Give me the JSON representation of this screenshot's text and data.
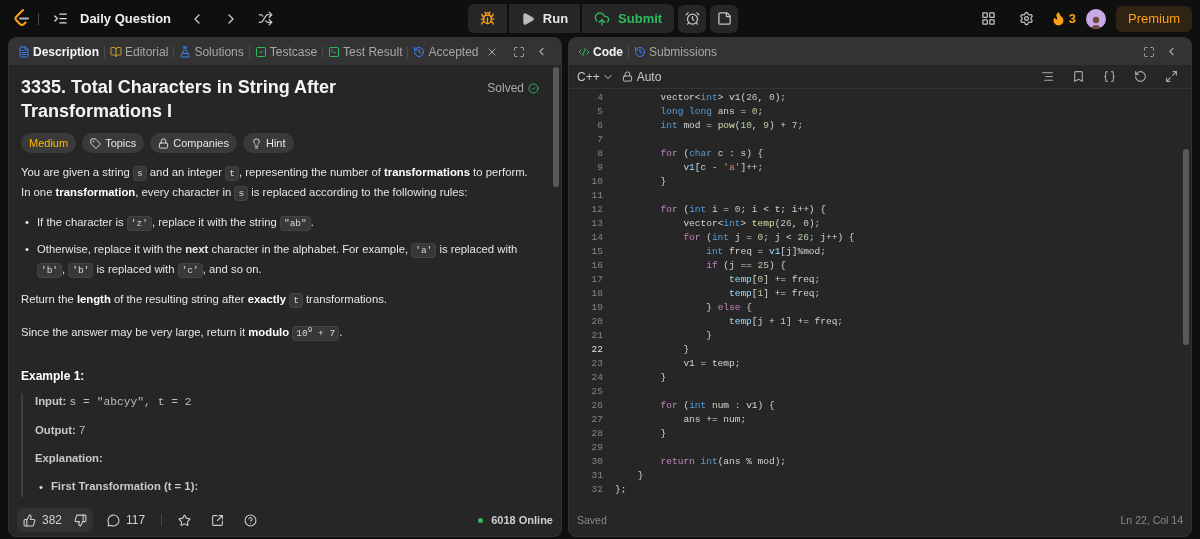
{
  "top_bar": {
    "title": "Daily Question",
    "run_label": "Run",
    "submit_label": "Submit",
    "streak": "3",
    "premium_label": "Premium"
  },
  "description_panel": {
    "tabs": [
      {
        "label": "Description",
        "selected": true,
        "closable": false
      },
      {
        "label": "Editorial",
        "selected": false,
        "closable": false
      },
      {
        "label": "Solutions",
        "selected": false,
        "closable": false
      },
      {
        "label": "Testcase",
        "selected": false,
        "closable": false
      },
      {
        "label": "Test Result",
        "selected": false,
        "closable": false
      },
      {
        "label": "Accepted",
        "selected": false,
        "closable": true
      }
    ],
    "title": "3335. Total Characters in String After Transformations I",
    "solved_label": "Solved",
    "difficulty": "Medium",
    "tags": [
      "Topics",
      "Companies",
      "Hint"
    ],
    "content": [
      {
        "kind": "paragraph",
        "segments": [
          {
            "kind": "text",
            "text": "You are given a string "
          },
          {
            "kind": "code",
            "text": "s"
          },
          {
            "kind": "text",
            "text": " and an integer "
          },
          {
            "kind": "code",
            "text": "t"
          },
          {
            "kind": "text",
            "text": ", representing the number of **transformations** to perform. In one **transformation**, every character in "
          },
          {
            "kind": "code",
            "text": "s"
          },
          {
            "kind": "text",
            "text": " is replaced according to the following rules:"
          }
        ]
      },
      {
        "kind": "bullet",
        "marker": "•",
        "segments": [
          {
            "kind": "text",
            "text": "If the character is "
          },
          {
            "kind": "code",
            "text": "'z'"
          },
          {
            "kind": "text",
            "text": ", replace it with the string "
          },
          {
            "kind": "code",
            "text": "\"ab\""
          },
          {
            "kind": "text",
            "text": "."
          }
        ]
      },
      {
        "kind": "bullet",
        "marker": "•",
        "segments": [
          {
            "kind": "text",
            "text": "Otherwise, replace it with the **next** character in the alphabet. For example, "
          },
          {
            "kind": "code",
            "text": "'a'"
          },
          {
            "kind": "text",
            "text": " is replaced with "
          },
          {
            "kind": "code",
            "text": "'b'"
          },
          {
            "kind": "text",
            "text": ", "
          },
          {
            "kind": "code",
            "text": "'b'"
          },
          {
            "kind": "text",
            "text": " is replaced with "
          },
          {
            "kind": "code",
            "text": "'c'"
          },
          {
            "kind": "text",
            "text": ", and so on."
          }
        ]
      },
      {
        "kind": "paragraph",
        "segments": [
          {
            "kind": "text",
            "text": "Return the **length** of the resulting string after **exactly** "
          },
          {
            "kind": "code",
            "text": "t"
          },
          {
            "kind": "text",
            "text": " transformations."
          }
        ]
      },
      {
        "kind": "paragraph",
        "segments": [
          {
            "kind": "text",
            "text": "Since the answer may be very large, return it **modulo** "
          },
          {
            "kind": "code",
            "text": "10$^{9}$ + 7"
          },
          {
            "kind": "text",
            "text": "."
          }
        ]
      },
      {
        "kind": "heading",
        "text": "Example 1:"
      },
      {
        "kind": "example",
        "lines": [
          {
            "label": "Input:",
            "value": "s = \"abcyy\", t = 2",
            "mono": true
          },
          {
            "label": "Output:",
            "value": "7",
            "mono": false
          },
          {
            "label": "Explanation:"
          }
        ],
        "bullets": [
          {
            "marker": "•",
            "text": "First Transformation (t = 1):"
          }
        ]
      }
    ],
    "likes": "382",
    "comments": "117",
    "online": "6018 Online"
  },
  "code_panel": {
    "tabs": [
      {
        "label": "Code",
        "selected": true
      },
      {
        "label": "Submissions",
        "selected": false
      }
    ],
    "language": "C++",
    "mode": "Auto",
    "lines": [
      {
        "number": "4",
        "current": false,
        "tokens": [
          {
            "kind": "plain",
            "text": "        vector<"
          },
          {
            "kind": "type",
            "text": "int"
          },
          {
            "kind": "plain",
            "text": "> v1("
          },
          {
            "kind": "number",
            "text": "26"
          },
          {
            "kind": "plain",
            "text": ", "
          },
          {
            "kind": "number",
            "text": "0"
          },
          {
            "kind": "plain",
            "text": ");"
          }
        ]
      },
      {
        "number": "5",
        "current": false,
        "tokens": [
          {
            "kind": "type",
            "text": "        long"
          },
          {
            "kind": "type",
            "text": " long"
          },
          {
            "kind": "plain",
            "text": " ans = "
          },
          {
            "kind": "number",
            "text": "0"
          },
          {
            "kind": "plain",
            "text": ";"
          }
        ]
      },
      {
        "number": "6",
        "current": false,
        "tokens": [
          {
            "kind": "type",
            "text": "        int"
          },
          {
            "kind": "plain",
            "text": " mod = "
          },
          {
            "kind": "function",
            "text": "pow"
          },
          {
            "kind": "plain",
            "text": "("
          },
          {
            "kind": "number",
            "text": "10"
          },
          {
            "kind": "plain",
            "text": ", "
          },
          {
            "kind": "number",
            "text": "9"
          },
          {
            "kind": "plain",
            "text": ") + "
          },
          {
            "kind": "number",
            "text": "7"
          },
          {
            "kind": "plain",
            "text": ";"
          }
        ]
      },
      {
        "number": "7",
        "current": false
      },
      {
        "number": "8",
        "current": false,
        "tokens": [
          {
            "kind": "keyword",
            "text": "        for"
          },
          {
            "kind": "plain",
            "text": " ("
          },
          {
            "kind": "type",
            "text": "char"
          },
          {
            "kind": "plain",
            "text": " c : s) {"
          }
        ]
      },
      {
        "number": "9",
        "current": false,
        "tokens": [
          {
            "kind": "variable",
            "text": "            v1"
          },
          {
            "kind": "plain",
            "text": "[c - "
          },
          {
            "kind": "string",
            "text": "'a'"
          },
          {
            "kind": "plain",
            "text": "]++;"
          }
        ]
      },
      {
        "number": "10",
        "current": false,
        "tokens": [
          {
            "kind": "plain",
            "text": "        }"
          }
        ]
      },
      {
        "number": "11",
        "current": false
      },
      {
        "number": "12",
        "current": false,
        "tokens": [
          {
            "kind": "keyword",
            "text": "        for"
          },
          {
            "kind": "plain",
            "text": " ("
          },
          {
            "kind": "type",
            "text": "int"
          },
          {
            "kind": "plain",
            "text": " i = "
          },
          {
            "kind": "number",
            "text": "0"
          },
          {
            "kind": "plain",
            "text": "; i < t; i++) {"
          }
        ]
      },
      {
        "number": "13",
        "current": false,
        "tokens": [
          {
            "kind": "plain",
            "text": "            vector<"
          },
          {
            "kind": "type",
            "text": "int"
          },
          {
            "kind": "plain",
            "text": "> "
          },
          {
            "kind": "function",
            "text": "temp"
          },
          {
            "kind": "plain",
            "text": "("
          },
          {
            "kind": "number",
            "text": "26"
          },
          {
            "kind": "plain",
            "text": ", "
          },
          {
            "kind": "number",
            "text": "0"
          },
          {
            "kind": "plain",
            "text": ");"
          }
        ]
      },
      {
        "number": "14",
        "current": false,
        "tokens": [
          {
            "kind": "keyword",
            "text": "            for"
          },
          {
            "kind": "plain",
            "text": " ("
          },
          {
            "kind": "type",
            "text": "int"
          },
          {
            "kind": "plain",
            "text": " j = "
          },
          {
            "kind": "number",
            "text": "0"
          },
          {
            "kind": "plain",
            "text": "; j < "
          },
          {
            "kind": "number",
            "text": "26"
          },
          {
            "kind": "plain",
            "text": "; j++) {"
          }
        ]
      },
      {
        "number": "15",
        "current": false,
        "tokens": [
          {
            "kind": "type",
            "text": "                int"
          },
          {
            "kind": "plain",
            "text": " freq = "
          },
          {
            "kind": "variable",
            "text": "v1"
          },
          {
            "kind": "plain",
            "text": "[j]%mod;"
          }
        ]
      },
      {
        "number": "16",
        "current": false,
        "tokens": [
          {
            "kind": "keyword",
            "text": "                if"
          },
          {
            "kind": "plain",
            "text": " (j == "
          },
          {
            "kind": "number",
            "text": "25"
          },
          {
            "kind": "plain",
            "text": ") {"
          }
        ]
      },
      {
        "number": "17",
        "current": false,
        "tokens": [
          {
            "kind": "variable",
            "text": "                    temp"
          },
          {
            "kind": "plain",
            "text": "["
          },
          {
            "kind": "number",
            "text": "0"
          },
          {
            "kind": "plain",
            "text": "] += freq;"
          }
        ]
      },
      {
        "number": "18",
        "current": false,
        "tokens": [
          {
            "kind": "variable",
            "text": "                    temp"
          },
          {
            "kind": "plain",
            "text": "["
          },
          {
            "kind": "number",
            "text": "1"
          },
          {
            "kind": "plain",
            "text": "] += freq;"
          }
        ]
      },
      {
        "number": "19",
        "current": false,
        "tokens": [
          {
            "kind": "plain",
            "text": "                } "
          },
          {
            "kind": "keyword",
            "text": "else"
          },
          {
            "kind": "plain",
            "text": " {"
          }
        ]
      },
      {
        "number": "20",
        "current": false,
        "tokens": [
          {
            "kind": "variable",
            "text": "                    temp"
          },
          {
            "kind": "plain",
            "text": "[j + "
          },
          {
            "kind": "number",
            "text": "1"
          },
          {
            "kind": "plain",
            "text": "] += freq;"
          }
        ]
      },
      {
        "number": "21",
        "current": false,
        "tokens": [
          {
            "kind": "plain",
            "text": "                }"
          }
        ]
      },
      {
        "number": "22",
        "current": true,
        "tokens": [
          {
            "kind": "plain",
            "text": "            }"
          }
        ]
      },
      {
        "number": "23",
        "current": false,
        "tokens": [
          {
            "kind": "plain",
            "text": "            v1 = temp;"
          }
        ]
      },
      {
        "number": "24",
        "current": false,
        "tokens": [
          {
            "kind": "plain",
            "text": "        }"
          }
        ]
      },
      {
        "number": "25",
        "current": false
      },
      {
        "number": "26",
        "current": false,
        "tokens": [
          {
            "kind": "keyword",
            "text": "        for"
          },
          {
            "kind": "plain",
            "text": " ("
          },
          {
            "kind": "type",
            "text": "int"
          },
          {
            "kind": "plain",
            "text": " num : v1) {"
          }
        ]
      },
      {
        "number": "27",
        "current": false,
        "tokens": [
          {
            "kind": "plain",
            "text": "            ans += num;"
          }
        ]
      },
      {
        "number": "28",
        "current": false,
        "tokens": [
          {
            "kind": "plain",
            "text": "        }"
          }
        ]
      },
      {
        "number": "29",
        "current": false
      },
      {
        "number": "30",
        "current": false,
        "tokens": [
          {
            "kind": "keyword",
            "text": "        return"
          },
          {
            "kind": "type",
            "text": " int"
          },
          {
            "kind": "plain",
            "text": "(ans % mod);"
          }
        ]
      },
      {
        "number": "31",
        "current": false,
        "tokens": [
          {
            "kind": "plain",
            "text": "    }"
          }
        ]
      },
      {
        "number": "32",
        "current": false,
        "tokens": [
          {
            "kind": "plain",
            "text": "};"
          }
        ]
      }
    ],
    "status": "Saved",
    "cursor": "Ln 22, Col 14"
  }
}
